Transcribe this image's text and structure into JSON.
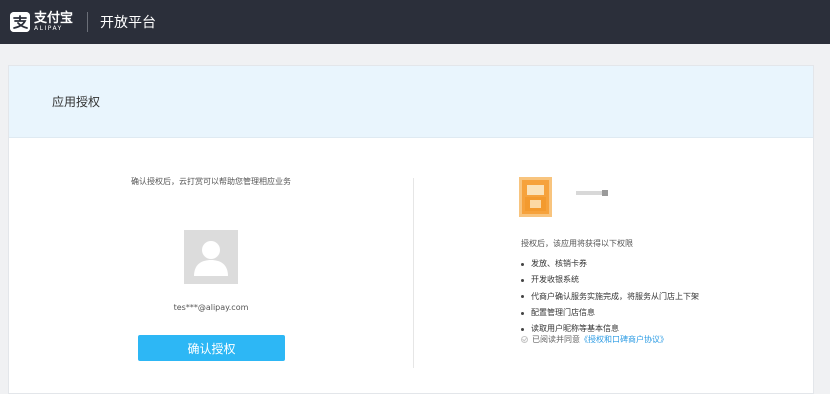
{
  "topbar": {
    "logo_cn": "支付宝",
    "logo_en": "ALIPAY",
    "title": "开放平台"
  },
  "header": {
    "title": "应用授权"
  },
  "left": {
    "description": "确认授权后，云打赏可以帮助您管理相应业务",
    "account": "tes***@alipay.com",
    "confirm_label": "确认授权"
  },
  "right": {
    "permissions_title": "授权后，该应用将获得以下权限",
    "permissions": [
      "发放、核销卡券",
      "开发收银系统",
      "代商户确认服务实施完成，将服务从门店上下架",
      "配置管理门店信息",
      "读取用户昵称等基本信息"
    ],
    "agree_prefix": "已阅读并同意",
    "agree_link": "《授权和口碑商户协议》"
  },
  "colors": {
    "topbar_bg": "#2b2f3a",
    "header_bg": "#e9f5fd",
    "primary_button": "#2db7f5",
    "link": "#2b9be4",
    "app_logo": "#f6a23c"
  },
  "icons": {
    "logo": "alipay-logo-icon",
    "avatar": "user-avatar-icon",
    "app_logo": "app-logo-icon",
    "checkbox": "check-icon"
  }
}
